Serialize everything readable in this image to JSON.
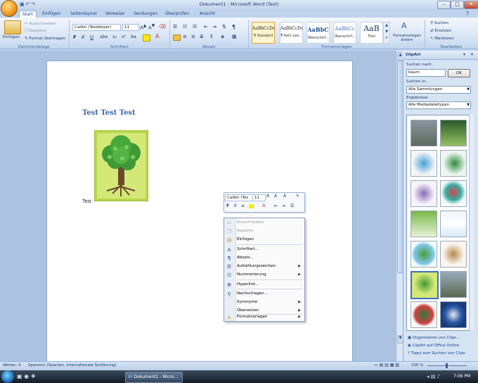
{
  "window": {
    "title": "Dokument1 - Microsoft Word (Test)"
  },
  "tabs": [
    "Start",
    "Einfügen",
    "Seitenlayout",
    "Verweise",
    "Sendungen",
    "Überprüfen",
    "Ansicht"
  ],
  "ribbon": {
    "clipboard": {
      "paste": "Einfügen",
      "cut": "Ausschneiden",
      "copy": "Kopieren",
      "format_painter": "Format übertragen",
      "group": "Zwischenablage"
    },
    "font": {
      "font_name": "Calibri (Textkörper)",
      "font_size": "11",
      "group": "Schriftart"
    },
    "paragraph": {
      "group": "Absatz"
    },
    "styles": {
      "items": [
        {
          "preview": "AaBbCcDc",
          "name": "¶ Standard"
        },
        {
          "preview": "AaBbCcDc",
          "name": "¶ Kein Lee..."
        },
        {
          "preview": "AaBbC",
          "name": "Überschrif..."
        },
        {
          "preview": "AaBbCc",
          "name": "Überschrif..."
        },
        {
          "preview": "AaB",
          "name": "Titel"
        }
      ],
      "change": "Formatvorlagen ändern",
      "group": "Formatvorlagen"
    },
    "editing": {
      "find": "Suchen",
      "replace": "Ersetzen",
      "select": "Markieren",
      "group": "Bearbeiten"
    }
  },
  "document": {
    "heading": "Test Test Test",
    "body": "Test"
  },
  "mini_toolbar": {
    "font_name": "Calibri (Tex",
    "font_size": "11"
  },
  "context_menu": [
    {
      "label": "Ausschneiden",
      "disabled": true,
      "icon": "scissors-icon"
    },
    {
      "label": "Kopieren",
      "disabled": true,
      "icon": "copy-icon"
    },
    {
      "label": "Einfügen",
      "disabled": false,
      "icon": "paste-icon"
    },
    {
      "label": "Schriftart...",
      "disabled": false,
      "icon": "font-icon"
    },
    {
      "label": "Absatz...",
      "disabled": false,
      "icon": "paragraph-icon"
    },
    {
      "label": "Aufzählungszeichen",
      "disabled": false,
      "icon": "bullets-icon",
      "submenu": true
    },
    {
      "label": "Nummerierung",
      "disabled": false,
      "icon": "numbering-icon",
      "submenu": true
    },
    {
      "label": "Hyperlink...",
      "disabled": false,
      "icon": "hyperlink-icon"
    },
    {
      "label": "Nachschlagen...",
      "disabled": false,
      "icon": "lookup-icon"
    },
    {
      "label": "Synonyme",
      "disabled": false,
      "submenu": true
    },
    {
      "label": "Übersetzen",
      "disabled": false,
      "submenu": true
    },
    {
      "label": "Formatvorlagen",
      "disabled": false,
      "icon": "styles-icon",
      "submenu": true
    }
  ],
  "clipart_pane": {
    "title": "ClipArt",
    "search_label": "Suchen nach:",
    "search_value": "baum",
    "ok_button": "OK",
    "search_in_label": "Suchen in:",
    "search_in_value": "Alle Sammlungen",
    "results_label": "Ergebnisse:",
    "results_value": "Alle Mediadateitypen",
    "links": [
      "Organisieren von Clips...",
      "ClipArt auf Office Online",
      "Tipps zum Suchen von Clips"
    ]
  },
  "statusbar": {
    "words": "Wörter: 4",
    "language": "Spanisch (Spanien, internationale Sortierung)",
    "zoom": "100 %"
  },
  "taskbar": {
    "task": "Dokument1 - Micro...",
    "time": "7:06 PM"
  },
  "colors": {
    "ribbon_text": "#15428b",
    "heading": "#3a66a8",
    "ribbon_bg": "#d5e3f4"
  }
}
